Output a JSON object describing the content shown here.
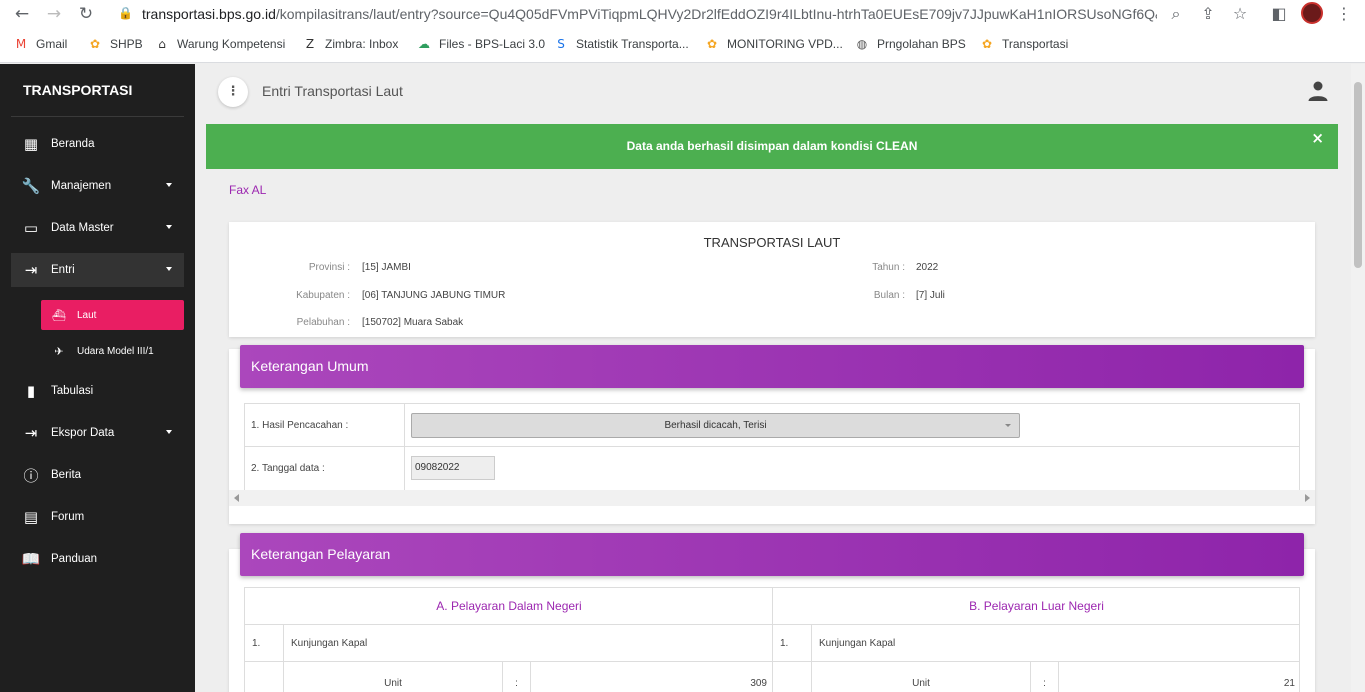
{
  "browser": {
    "url_host": "transportasi.bps.go.id",
    "url_path": "/kompilasitrans/laut/entry?source=Qu4Q05dFVmPViTiqpmLQHVy2Dr2lfEddOZI9r4ILbtInu-htrhTa0EUEsE709jv7JJpuwKaH1nIORSUsoNGf6Q&a..."
  },
  "bookmarks": [
    {
      "label": "Gmail",
      "icon": "gmail-icon",
      "color": "#ea4335"
    },
    {
      "label": "SHPB",
      "icon": "sipadu-icon",
      "color": "#f5a623"
    },
    {
      "label": "Warung Kompetensi",
      "icon": "home-icon",
      "color": "#333333"
    },
    {
      "label": "Zimbra: Inbox",
      "icon": "zimbra-icon",
      "color": "#333333"
    },
    {
      "label": "Files - BPS-Laci 3.0",
      "icon": "cloud-icon",
      "color": "#2e9e5e"
    },
    {
      "label": "Statistik Transporta...",
      "icon": "sharepoint-icon",
      "color": "#1a73e8"
    },
    {
      "label": "MONITORING VPD...",
      "icon": "sipadu-icon",
      "color": "#f5a623"
    },
    {
      "label": "Prngolahan BPS",
      "icon": "globe-icon",
      "color": "#555555"
    },
    {
      "label": "Transportasi",
      "icon": "sipadu-icon",
      "color": "#f5a623"
    }
  ],
  "sidebar": {
    "brand": "TRANSPORTASI",
    "items": [
      {
        "label": "Beranda",
        "icon": "dashboard-icon",
        "caret": false
      },
      {
        "label": "Manajemen",
        "icon": "wrench-icon",
        "caret": true
      },
      {
        "label": "Data Master",
        "icon": "folder-icon",
        "caret": true
      },
      {
        "label": "Entri",
        "icon": "login-icon",
        "caret": true
      },
      {
        "label": "Tabulasi",
        "icon": "bar-chart-icon",
        "caret": false
      },
      {
        "label": "Ekspor Data",
        "icon": "export-icon",
        "caret": true
      },
      {
        "label": "Berita",
        "icon": "info-icon",
        "caret": false
      },
      {
        "label": "Forum",
        "icon": "forum-icon",
        "caret": false
      },
      {
        "label": "Panduan",
        "icon": "book-icon",
        "caret": false
      }
    ],
    "sub_items": [
      {
        "label": "Laut",
        "icon": "ship-icon"
      },
      {
        "label": "Udara Model III/1",
        "icon": "plane-icon"
      }
    ]
  },
  "topbar": {
    "title": "Entri Transportasi Laut"
  },
  "alert": {
    "message": "Data anda berhasil disimpan dalam kondisi CLEAN",
    "close": "×",
    "color": "#4caf50"
  },
  "fax_link": "Fax AL",
  "header_card": {
    "title": "TRANSPORTASI LAUT",
    "provinsi_label": "Provinsi :",
    "provinsi_value": "[15] JAMBI",
    "kabupaten_label": "Kabupaten :",
    "kabupaten_value": "[06] TANJUNG JABUNG TIMUR",
    "pelabuhan_label": "Pelabuhan :",
    "pelabuhan_value": "[150702] Muara Sabak",
    "tahun_label": "Tahun :",
    "tahun_value": "2022",
    "bulan_label": "Bulan :",
    "bulan_value": "[7] Juli"
  },
  "keterangan_umum": {
    "title": "Keterangan Umum",
    "hasil_label": "1. Hasil Pencacahan :",
    "hasil_value": "Berhasil dicacah, Terisi",
    "tanggal_label": "2. Tanggal data :",
    "tanggal_value": "09082022"
  },
  "keterangan_pelayaran": {
    "title": "Keterangan Pelayaran",
    "dalam_negeri": {
      "heading": "A. Pelayaran Dalam Negeri",
      "row_num": "1.",
      "row_label": "Kunjungan Kapal",
      "unit_label": "Unit",
      "colon": ":",
      "unit_value": "309"
    },
    "luar_negeri": {
      "heading": "B. Pelayaran Luar Negeri",
      "row_num": "1.",
      "row_label": "Kunjungan Kapal",
      "unit_label": "Unit",
      "colon": ":",
      "unit_value": "21"
    }
  },
  "colors": {
    "accent": "#e91e63",
    "panel": "#9c27b0",
    "sidebar": "#1f1f1f"
  }
}
